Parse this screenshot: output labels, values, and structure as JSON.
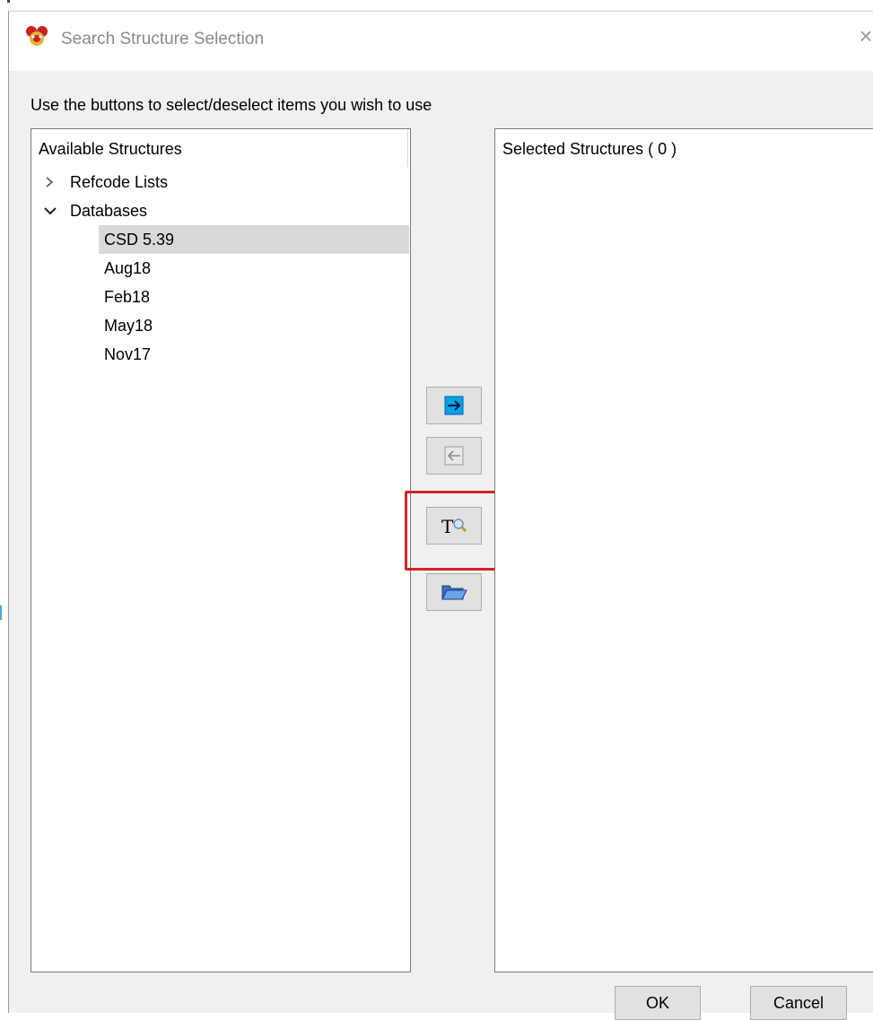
{
  "window": {
    "title": "Search Structure Selection",
    "close_glyph": "×"
  },
  "instruction": "Use the buttons to select/deselect items you wish to use",
  "available": {
    "header": "Available Structures",
    "groups": [
      {
        "label": "Refcode Lists",
        "expanded": false
      },
      {
        "label": "Databases",
        "expanded": true
      }
    ],
    "databases": [
      "CSD 5.39",
      "Aug18",
      "Feb18",
      "May18",
      "Nov17"
    ],
    "selected_item": "CSD 5.39"
  },
  "selected": {
    "header": "Selected Structures ( 0 )"
  },
  "side_buttons": [
    {
      "icon": "arrow-right-icon"
    },
    {
      "icon": "arrow-left-icon"
    },
    {
      "icon": "text-search-icon"
    },
    {
      "icon": "folder-open-icon"
    }
  ],
  "footer": {
    "ok_label": "OK",
    "cancel_label": "Cancel"
  },
  "colors": {
    "accent_blue": "#00a2e8",
    "highlight_red": "#d2232a",
    "selection_gray": "#d9d9d9",
    "dialog_bg": "#f0f0f0"
  }
}
